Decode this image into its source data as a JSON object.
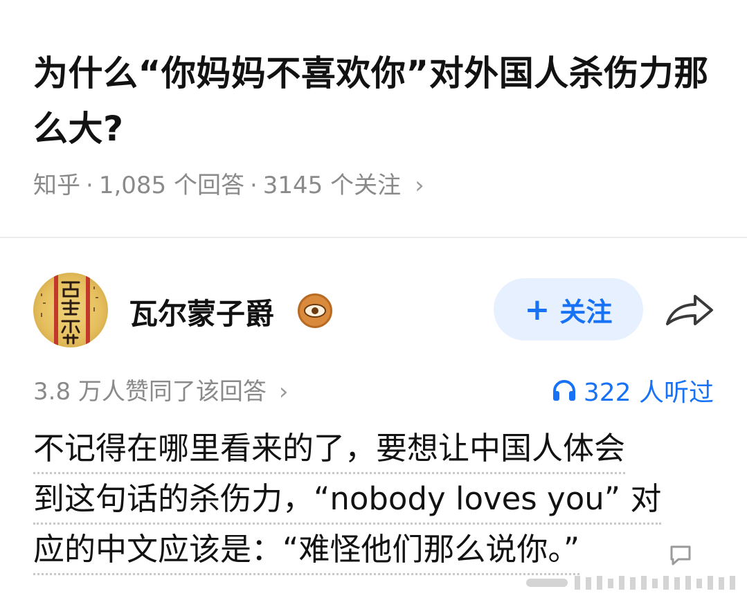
{
  "question": {
    "title": "为什么“你妈妈不喜欢你”对外国人杀伤力那么大?",
    "source": "知乎",
    "answers_count": "1,085 个回答",
    "followers_count": "3145 个关注",
    "separator": "·",
    "chevron": "›"
  },
  "answer": {
    "author_name": "瓦尔蒙子爵",
    "follow_label": "关注",
    "follow_plus": "+",
    "votes_text": "3.8 万人赞同了该回答",
    "listen_text": "322 人听过",
    "content_lines": [
      "不记得在哪里看来的了，要想让中国人体会",
      "到这句话的杀伤力，“nobody loves you” 对",
      "应的中文应该是：“难怪他们那么说你。”"
    ]
  },
  "colors": {
    "accent": "#1772f6",
    "follow_bg": "#e7f0fe",
    "muted_text": "#8a8a8a",
    "title_text": "#121212"
  },
  "icons": {
    "share": "share-arrow-icon",
    "badge": "eye-badge-icon",
    "listen": "headphones-icon",
    "comment": "comment-bubble-icon",
    "meta_chevron": "chevron-right-icon"
  }
}
